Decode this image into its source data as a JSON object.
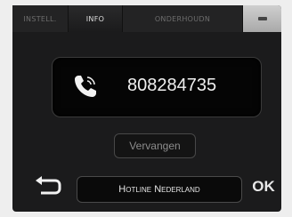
{
  "tabs": [
    {
      "label": "INSTELL.",
      "active": false
    },
    {
      "label": "INFO",
      "active": true
    },
    {
      "label": "ONDERHOUDN",
      "active": false
    }
  ],
  "contact": {
    "phone_icon": "phone-handset-icon",
    "phone_number": "808284735",
    "replace_label": "Vervangen"
  },
  "footer": {
    "back_icon": "return-arrow-icon",
    "hotline_label": "Hotline Nederland",
    "ok_label": "OK"
  },
  "colors": {
    "background": "#1b1b1c",
    "text": "#f0f0f0",
    "inactive_tab_text": "#6d6d6d"
  }
}
